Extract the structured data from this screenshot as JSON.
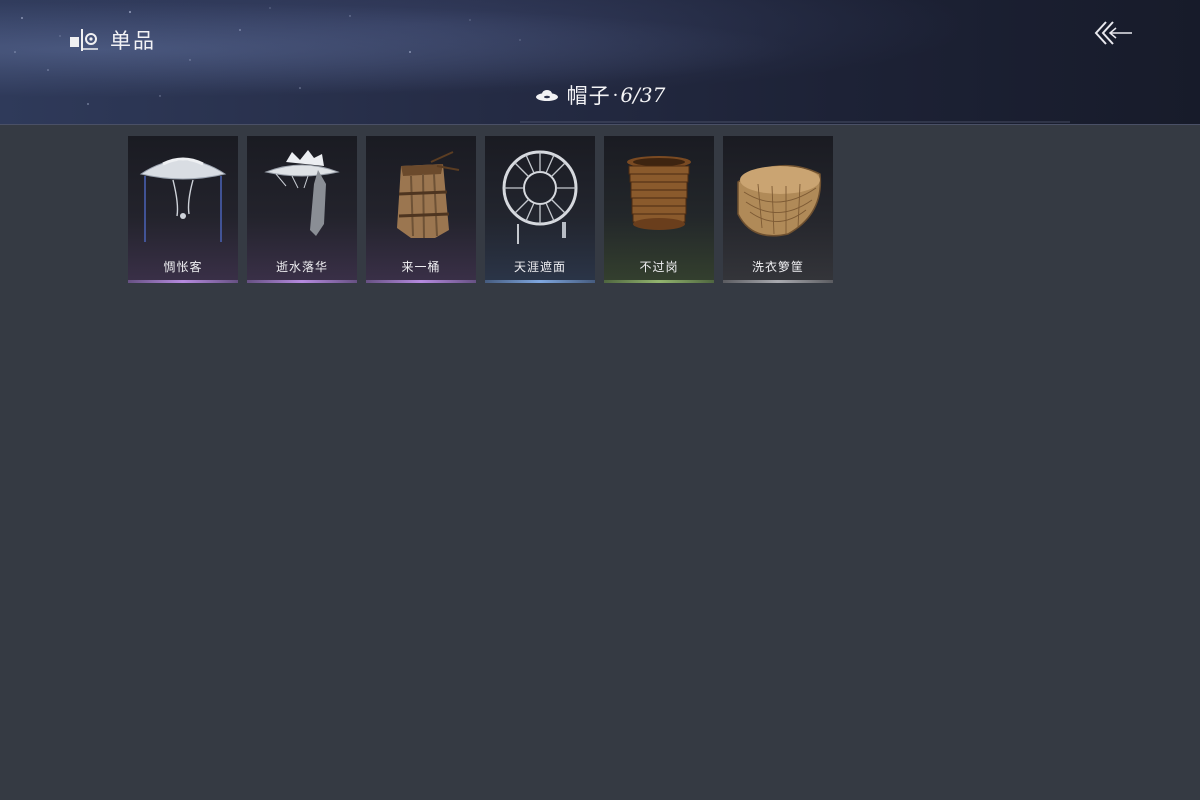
{
  "header": {
    "brand_label": "单品",
    "brand_icon": "wardrobe-icon",
    "back_icon": "back-arrow-icon"
  },
  "category": {
    "icon": "hat-icon",
    "label": "帽子",
    "separator": "·",
    "count": "6/37"
  },
  "items": [
    {
      "name": "惆怅客",
      "rarity": "purple",
      "icon": "wide-veiled-hat"
    },
    {
      "name": "逝水落华",
      "rarity": "purple",
      "icon": "flower-hat-with-veil"
    },
    {
      "name": "来一桶",
      "rarity": "purple",
      "icon": "wooden-bucket-hat"
    },
    {
      "name": "天涯遮面",
      "rarity": "blue",
      "icon": "woven-ring-hat"
    },
    {
      "name": "不过岗",
      "rarity": "green",
      "icon": "stacked-bowls-hat"
    },
    {
      "name": "洗衣箩筐",
      "rarity": "gray",
      "icon": "wicker-basket-hat"
    }
  ],
  "colors": {
    "background": "#353a43",
    "header_start": "#2f3a5a",
    "header_end": "#171b2a",
    "rarity_purple": "#b68be0",
    "rarity_blue": "#7fa7e0",
    "rarity_green": "#93b56f",
    "rarity_gray": "#a9aab0"
  }
}
